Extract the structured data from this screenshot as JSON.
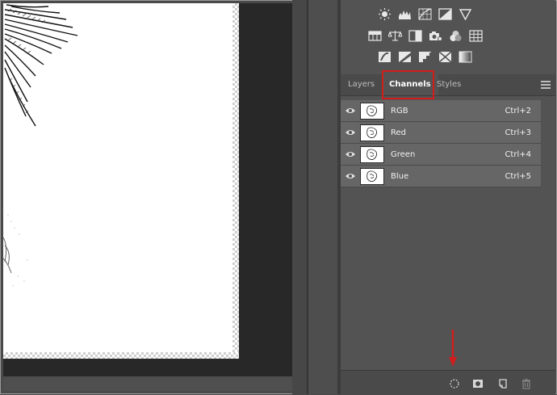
{
  "panel": {
    "tabs": [
      {
        "label": "Layers",
        "active": false
      },
      {
        "label": "Channels",
        "active": true
      },
      {
        "label": "Styles",
        "active": false
      }
    ],
    "adjustment_icons_row1": [
      "brightness-contrast-icon",
      "levels-icon",
      "curves-icon",
      "exposure-icon",
      "vibrance-icon"
    ],
    "adjustment_icons_row2": [
      "hue-saturation-icon",
      "color-balance-icon",
      "black-white-icon",
      "photo-filter-icon",
      "channel-mixer-icon",
      "color-lookup-icon"
    ],
    "adjustment_icons_row3": [
      "invert-icon",
      "posterize-icon",
      "threshold-icon",
      "selective-color-icon",
      "gradient-map-icon"
    ],
    "channels": [
      {
        "name": "RGB",
        "shortcut": "Ctrl+2"
      },
      {
        "name": "Red",
        "shortcut": "Ctrl+3"
      },
      {
        "name": "Green",
        "shortcut": "Ctrl+4"
      },
      {
        "name": "Blue",
        "shortcut": "Ctrl+5"
      }
    ],
    "bottom_icons": [
      "load-channel-as-selection-icon",
      "save-selection-as-channel-icon",
      "new-channel-icon",
      "delete-channel-icon"
    ]
  },
  "colors": {
    "highlight": "#d21d1d",
    "panel_bg": "#535353",
    "row_bg": "#666666"
  }
}
